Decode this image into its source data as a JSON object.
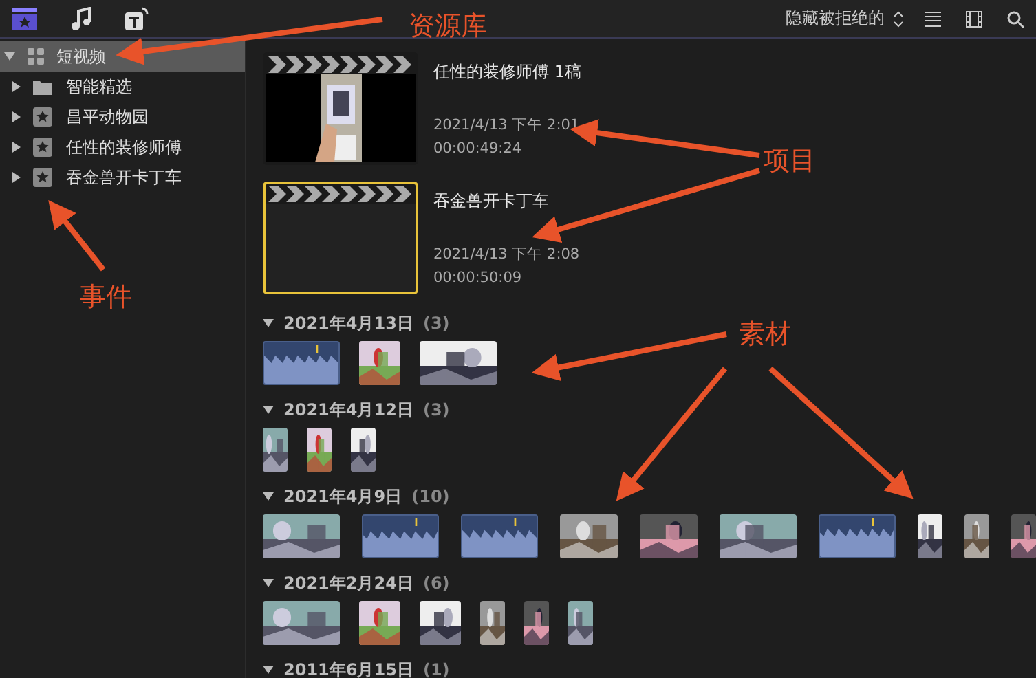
{
  "toolbar": {
    "filter": "隐藏被拒绝的"
  },
  "library": {
    "name": "短视频",
    "expanded": true,
    "selected": true,
    "children": [
      {
        "name": "智能精选",
        "kind": "folder",
        "expanded": false
      },
      {
        "name": "昌平动物园",
        "kind": "event",
        "expanded": false
      },
      {
        "name": "任性的装修师傅",
        "kind": "event",
        "expanded": false
      },
      {
        "name": "吞金兽开卡丁车",
        "kind": "event",
        "expanded": false
      }
    ]
  },
  "projects": [
    {
      "title": "任性的装修师傅 1稿",
      "date": "2021/4/13 下午 2:01",
      "duration": "00:00:49:24",
      "kind": "picture",
      "selected": false
    },
    {
      "title": "吞金兽开卡丁车",
      "date": "2021/4/13 下午 2:08",
      "duration": "00:00:50:09",
      "kind": "blank",
      "selected": true
    }
  ],
  "groups": [
    {
      "date": "2021年4月13日",
      "count": "(3)",
      "expanded": true,
      "clips": [
        {
          "kind": "audio"
        },
        {
          "kind": "square"
        },
        {
          "kind": "landscape"
        }
      ]
    },
    {
      "date": "2021年4月12日",
      "count": "(3)",
      "expanded": true,
      "clips": [
        {
          "kind": "portrait"
        },
        {
          "kind": "portrait"
        },
        {
          "kind": "portrait"
        }
      ]
    },
    {
      "date": "2021年4月9日",
      "count": "(10)",
      "expanded": true,
      "clips": [
        {
          "kind": "landscape"
        },
        {
          "kind": "audio"
        },
        {
          "kind": "audio"
        },
        {
          "kind": "narrow"
        },
        {
          "kind": "narrow"
        },
        {
          "kind": "landscape"
        },
        {
          "kind": "audio"
        },
        {
          "kind": "portrait"
        },
        {
          "kind": "portrait"
        },
        {
          "kind": "portrait"
        }
      ]
    },
    {
      "date": "2021年2月24日",
      "count": "(6)",
      "expanded": true,
      "clips": [
        {
          "kind": "landscape"
        },
        {
          "kind": "square"
        },
        {
          "kind": "square"
        },
        {
          "kind": "portrait"
        },
        {
          "kind": "portrait"
        },
        {
          "kind": "portrait"
        }
      ]
    },
    {
      "date": "2011年6月15日",
      "count": "(1)",
      "expanded": true
    }
  ],
  "annotations": [
    {
      "label": "资源库"
    },
    {
      "label": "事件"
    },
    {
      "label": "项目"
    },
    {
      "label": "素材"
    }
  ]
}
